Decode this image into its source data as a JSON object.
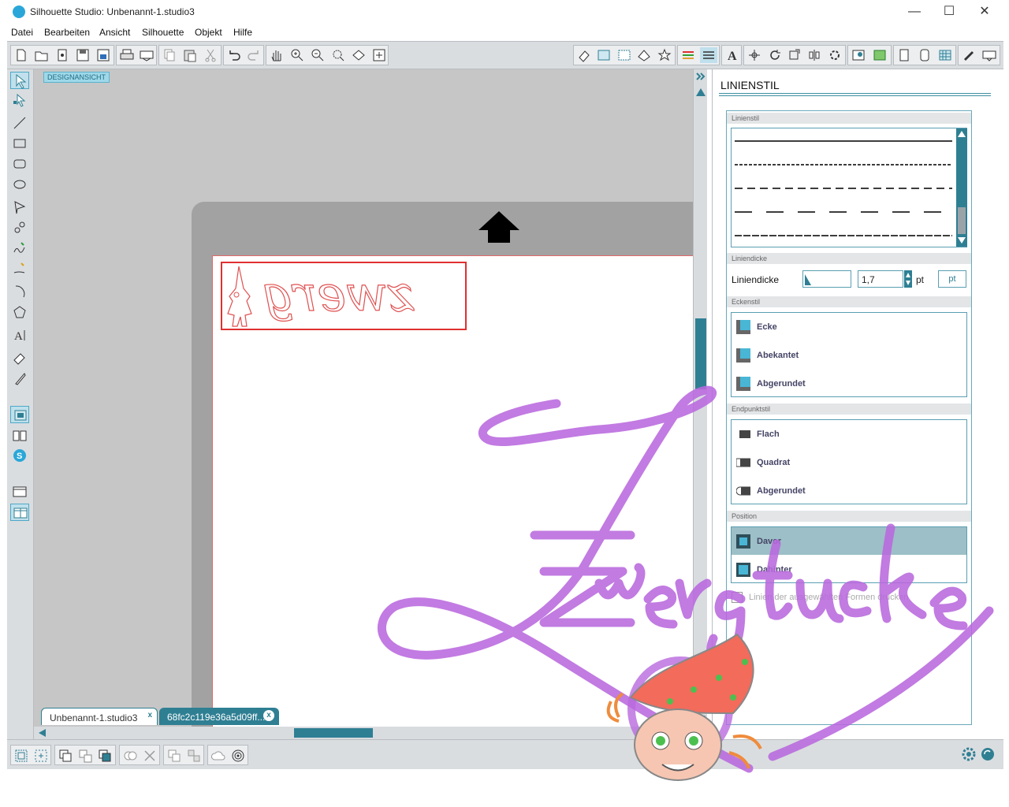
{
  "window": {
    "title": "Silhouette Studio: Unbenannt-1.studio3",
    "app_icon": "silhouette-logo-icon",
    "controls": [
      "minimize-icon",
      "maximize-icon",
      "close-icon"
    ],
    "minimize_glyph": "—",
    "maximize_glyph": "☐",
    "close_glyph": "✕"
  },
  "menubar": {
    "items": [
      "Datei",
      "Bearbeiten",
      "Ansicht",
      "Silhouette",
      "Objekt",
      "Hilfe"
    ]
  },
  "toolbar": {
    "left_icons": [
      "new-document-icon",
      "open-icon",
      "open-library-icon",
      "save-icon",
      "save-as-icon",
      "print-icon",
      "print-cut-icon",
      "copy-icon",
      "paste-icon",
      "cut-icon",
      "undo-icon",
      "redo-icon",
      "pan-icon",
      "zoom-in-icon",
      "zoom-out-icon",
      "zoom-select-icon",
      "zoom-fit-icon",
      "fit-page-icon"
    ],
    "right_icons": [
      "eraser-panel-icon",
      "page-setup-icon",
      "grid-icon",
      "library-icon",
      "star-icon",
      "line-color-icon",
      "line-style-icon",
      "text-icon",
      "transform-icon",
      "rotate-icon",
      "scale-icon",
      "align-icon",
      "settings-icon",
      "trace-icon",
      "fill-icon",
      "page-icon",
      "offset-icon",
      "pattern-icon",
      "cut-settings-icon",
      "send-icon"
    ]
  },
  "left_tools": [
    "select-icon",
    "point-edit-icon",
    "line-icon",
    "rectangle-icon",
    "rounded-rectangle-icon",
    "ellipse-icon",
    "polygon-icon",
    "curve-icon",
    "freehand-icon",
    "smooth-freehand-icon",
    "arc-icon",
    "regular-polygon-icon",
    "text-tool-icon",
    "eraser-icon",
    "knife-icon",
    "design-view-icon",
    "library-view-icon",
    "store-icon",
    "single-view-icon",
    "split-view-icon"
  ],
  "canvas": {
    "view_label": "DESIGNANSICHT",
    "design_text": "zwerg",
    "selection_color": "#e03030"
  },
  "tabs": [
    {
      "label": "Unbenannt-1.studio3",
      "close": "x",
      "active": true
    },
    {
      "label": "68fc2c119e36a5d09ff...",
      "close": "x",
      "active": false
    }
  ],
  "panel": {
    "title": "LINIENSTIL",
    "line_style_section": "Linienstil",
    "line_styles": [
      "solid",
      "dash-short",
      "dash-medium",
      "dash-long",
      "dash-dense"
    ],
    "thickness_section": "Liniendicke",
    "thickness_label": "Liniendicke",
    "thickness_value": "1,7",
    "thickness_unit": "pt",
    "unit_button": "pt",
    "corner_section": "Eckenstil",
    "corner_options": [
      "Ecke",
      "Abekantet",
      "Abgerundet"
    ],
    "cap_section": "Endpunktstil",
    "cap_options": [
      "Flach",
      "Quadrat",
      "Abgerundet"
    ],
    "position_section": "Position",
    "position_options": [
      {
        "label": "Davor",
        "selected": true
      },
      {
        "label": "Dahinter",
        "selected": false
      }
    ],
    "print_checkbox_label": "Linien der ausgewählten Formen drucken"
  },
  "bottom_toolbar": {
    "icons": [
      "group-icon",
      "ungroup-icon",
      "compound-icon",
      "release-compound-icon",
      "bring-front-icon",
      "weld-icon",
      "delete-icon",
      "duplicate-icon",
      "mirror-icon",
      "cloud-icon",
      "offset-target-icon"
    ],
    "right_icons": [
      "gear-icon",
      "refresh-icon"
    ]
  },
  "watermark": {
    "text": "Zwergstücke",
    "color": "#b969de"
  },
  "colors": {
    "accent": "#2f7f93",
    "selected_row": "#9dbfc7",
    "swatch_blue": "#49b6d6"
  }
}
